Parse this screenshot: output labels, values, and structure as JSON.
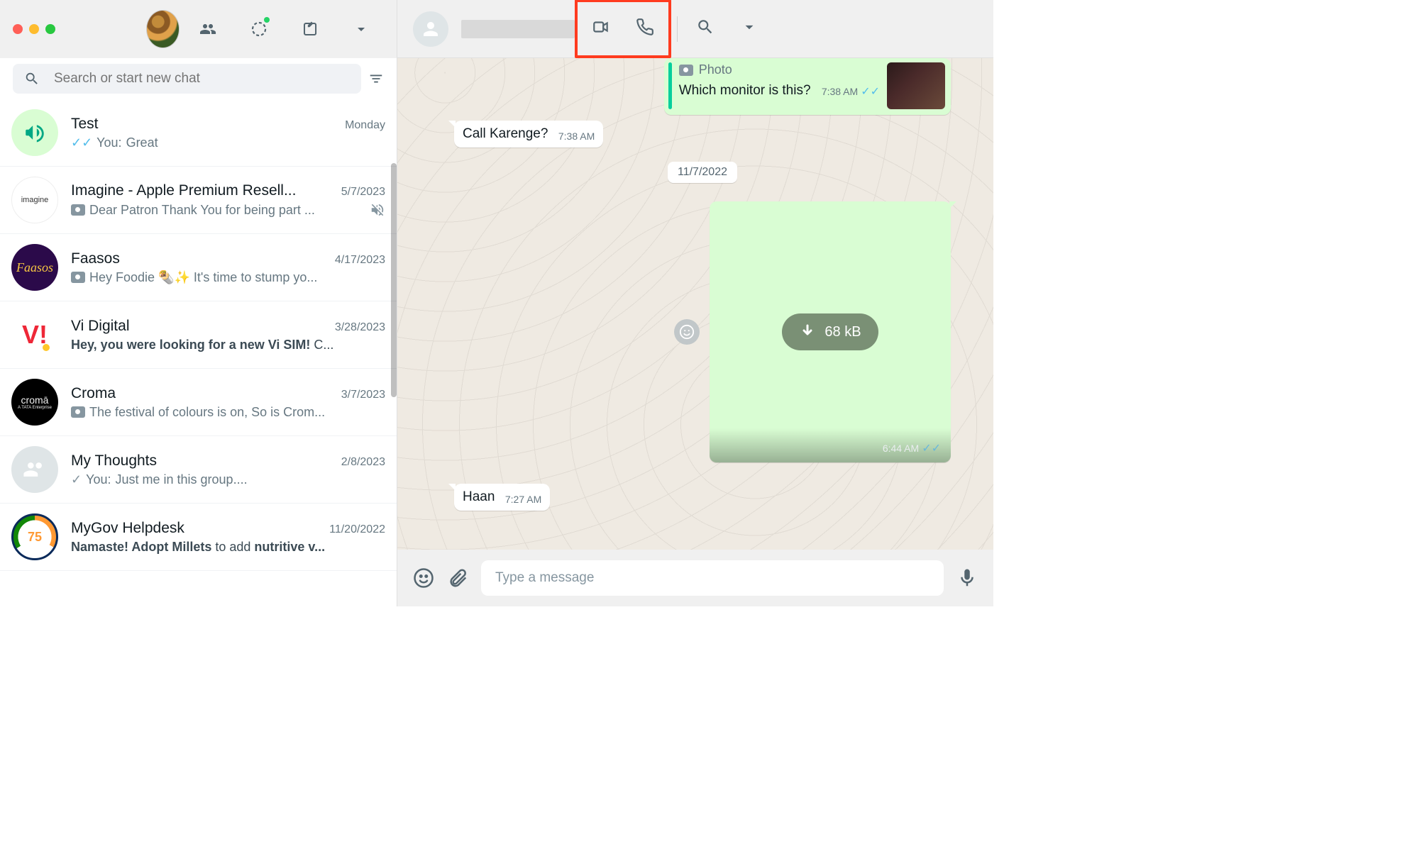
{
  "search": {
    "placeholder": "Search or start new chat"
  },
  "chats": [
    {
      "name": "Test",
      "time": "Monday",
      "preview": "Great",
      "prefix": "You: ",
      "check": "read",
      "avatar": "channel"
    },
    {
      "name": "Imagine - Apple Premium Resell...",
      "time": "5/7/2023",
      "preview": "Dear Patron Thank You for being part ...",
      "photo": true,
      "muted": true,
      "avatar": "imagine"
    },
    {
      "name": "Faasos",
      "time": "4/17/2023",
      "preview": "Hey Foodie 🌯✨ It's time to stump yo...",
      "photo": true,
      "avatar": "faasos"
    },
    {
      "name": "Vi Digital",
      "time": "3/28/2023",
      "preview_bold": "Hey, you were looking for a new Vi SIM!",
      "preview_tail": " C...",
      "avatar": "vi"
    },
    {
      "name": "Croma",
      "time": "3/7/2023",
      "preview": "The festival of colours is on,  So is Crom...",
      "photo": true,
      "avatar": "croma"
    },
    {
      "name": "My Thoughts",
      "time": "2/8/2023",
      "preview": "Just me in this group....",
      "prefix": "You: ",
      "check": "sent",
      "avatar": "group"
    },
    {
      "name": "MyGov Helpdesk",
      "time": "11/20/2022",
      "preview_bold": "Namaste! Adopt Millets",
      "preview_mid": " to add ",
      "preview_bold2": "nutritive v...",
      "avatar": "mygov"
    }
  ],
  "conversation": {
    "quoted": {
      "label": "Photo",
      "caption": "Which monitor is this?",
      "time": "7:38 AM"
    },
    "in1": {
      "text": "Call Karenge?",
      "time": "7:38 AM"
    },
    "date_divider": "11/7/2022",
    "media": {
      "size": "68 kB",
      "time": "6:44 AM"
    },
    "in2": {
      "text": "Haan",
      "time": "7:27 AM"
    }
  },
  "composer": {
    "placeholder": "Type a message"
  }
}
